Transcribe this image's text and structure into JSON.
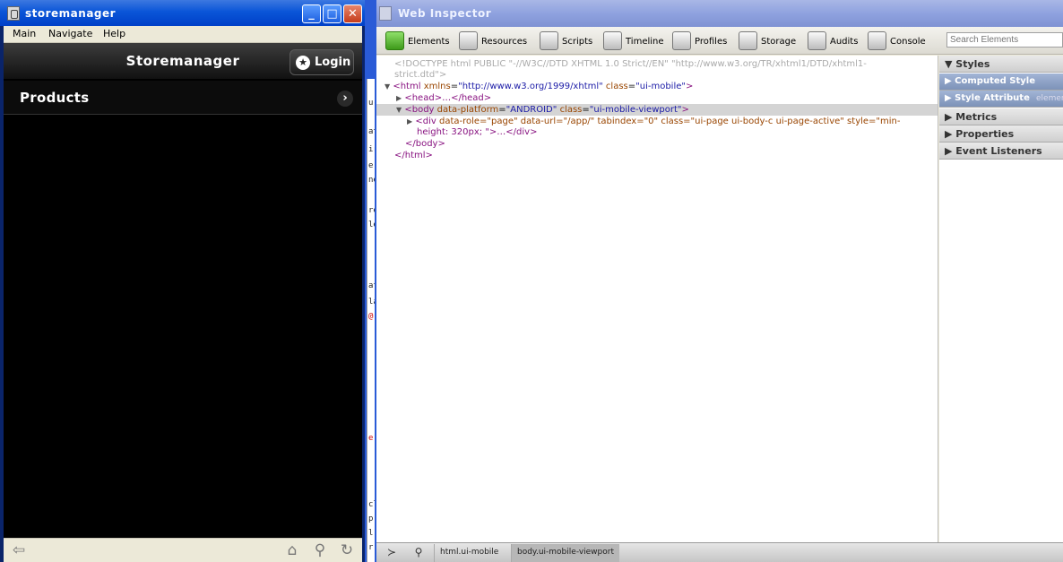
{
  "left_window": {
    "title": "storemanager",
    "menu": [
      "Main",
      "Navigate",
      "Help"
    ],
    "header_title": "Storemanager",
    "login_label": "Login",
    "list_items": [
      {
        "label": "Products"
      }
    ],
    "icons": {
      "back": "back-arrow-icon",
      "home": "home-icon",
      "search": "search-icon",
      "refresh": "refresh-icon"
    }
  },
  "middle_strip": {
    "glyphs": [
      "u-",
      "at",
      "ir",
      "e",
      "ne",
      "re",
      "le",
      "at",
      "la",
      "@",
      "e",
      "cl",
      "p",
      "l",
      "r"
    ]
  },
  "inspector": {
    "title": "Web Inspector",
    "tools": [
      "Elements",
      "Resources",
      "Scripts",
      "Timeline",
      "Profiles",
      "Storage",
      "Audits",
      "Console"
    ],
    "search_placeholder": "Search Elements",
    "dom": {
      "doctype_1": "<!DOCTYPE html PUBLIC \"-//W3C//DTD XHTML 1.0 Strict//EN\" \"http://www.w3.org/TR/xhtml1/DTD/xhtml1-",
      "doctype_2": "strict.dtd\">",
      "html_tag": "<html",
      "html_attr1_name": "xmlns",
      "html_attr1_val": "\"http://www.w3.org/1999/xhtml\"",
      "html_attr2_name": "class",
      "html_attr2_val": "\"ui-mobile\"",
      "head_line": "<head>…</head>",
      "body_tag": "<body",
      "body_attr1_name": "data-platform",
      "body_attr1_val": "\"ANDROID\"",
      "body_attr2_name": "class",
      "body_attr2_val": "\"ui-mobile-viewport\"",
      "div_tag": "<div",
      "div_attrs_1": "data-role=\"page\" data-url=\"/app/\" tabindex=\"0\" class=\"ui-page ui-body-c ui-page-active\" style=\"min-",
      "div_attrs_2": "height: 320px; \">…</div>",
      "body_close": "</body>",
      "html_close": "</html>"
    },
    "side": {
      "styles": "Styles",
      "computed_style": "Computed Style",
      "style_attribute": "Style Attribute",
      "style_attribute_extra": "elemen",
      "metrics": "Metrics",
      "properties": "Properties",
      "event_listeners": "Event Listeners"
    },
    "breadcrumbs": [
      "html.ui-mobile",
      "body.ui-mobile-viewport"
    ]
  }
}
